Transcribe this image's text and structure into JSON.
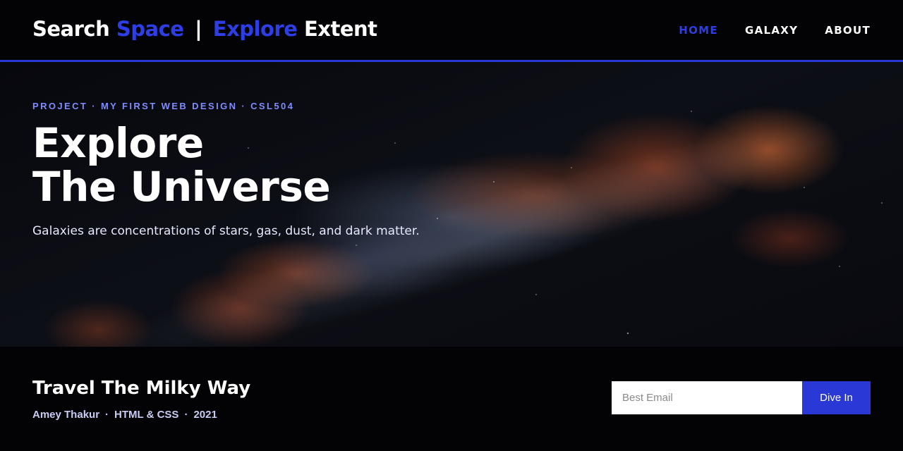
{
  "header": {
    "brand": {
      "word1": "Search",
      "word2": "Space",
      "separator": "|",
      "word3": "Explore",
      "word4": "Extent"
    },
    "nav": [
      {
        "label": "HOME",
        "active": true
      },
      {
        "label": "GALAXY",
        "active": false
      },
      {
        "label": "ABOUT",
        "active": false
      }
    ]
  },
  "hero": {
    "eyebrow": "PROJECT · MY FIRST WEB DESIGN · CSL504",
    "headline_line1": "Explore",
    "headline_line2": "The Universe",
    "subtitle": "Galaxies are concentrations of stars, gas, dust, and dark matter."
  },
  "footer": {
    "title": "Travel The Milky Way",
    "credits": [
      "Amey Thakur",
      "HTML & CSS",
      "2021"
    ],
    "credit_separator": "·",
    "email_placeholder": "Best Email",
    "button_label": "Dive In"
  },
  "colors": {
    "accent": "#2a38d6",
    "eyebrow": "#7f8cff",
    "background": "#030305"
  }
}
